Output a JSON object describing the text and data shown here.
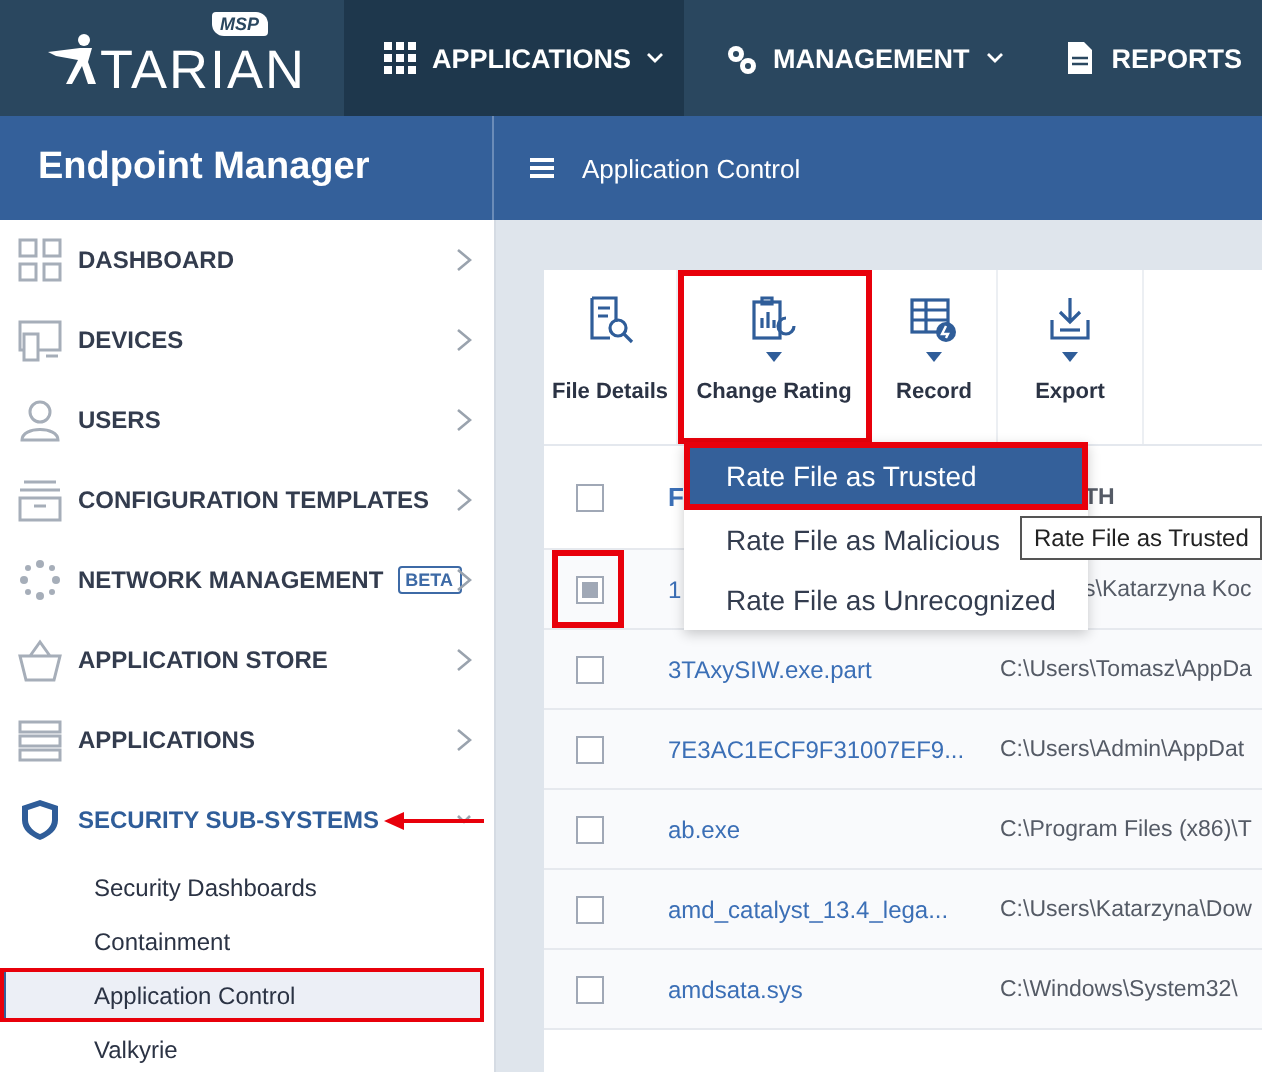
{
  "app_header": {
    "logo": {
      "text": "TARIAN",
      "badge": "MSP"
    },
    "nav": [
      {
        "label": "APPLICATIONS",
        "selected": true,
        "dropdown": true
      },
      {
        "label": "MANAGEMENT",
        "selected": false,
        "dropdown": true
      },
      {
        "label": "REPORTS",
        "selected": false,
        "dropdown": false
      }
    ]
  },
  "sidebar": {
    "title": "Endpoint Manager",
    "items": [
      {
        "label": "DASHBOARD",
        "expanded": false,
        "arrow": false
      },
      {
        "label": "DEVICES",
        "expanded": false,
        "arrow": false
      },
      {
        "label": "USERS",
        "expanded": false,
        "arrow": false
      },
      {
        "label": "CONFIGURATION TEMPLATES",
        "expanded": false,
        "arrow": false
      },
      {
        "label": "NETWORK MANAGEMENT",
        "badge": "BETA",
        "expanded": false,
        "arrow": false
      },
      {
        "label": "APPLICATION STORE",
        "expanded": false,
        "arrow": false
      },
      {
        "label": "APPLICATIONS",
        "expanded": false,
        "arrow": false
      },
      {
        "label": "SECURITY SUB-SYSTEMS",
        "expanded": true,
        "arrow": true,
        "children": [
          {
            "label": "Security Dashboards",
            "selected": false,
            "highlighted": false
          },
          {
            "label": "Containment",
            "selected": false,
            "highlighted": false
          },
          {
            "label": "Application Control",
            "selected": true,
            "highlighted": true
          },
          {
            "label": "Valkyrie",
            "selected": false,
            "highlighted": false
          }
        ]
      }
    ]
  },
  "page_title": "Application Control",
  "toolbar": [
    {
      "label": "File Details",
      "dropdown": false,
      "highlighted": false
    },
    {
      "label": "Change Rating",
      "dropdown": true,
      "highlighted": true
    },
    {
      "label": "Record",
      "dropdown": true,
      "highlighted": false
    },
    {
      "label": "Export",
      "dropdown": true,
      "highlighted": false
    }
  ],
  "dropdown_menu": [
    {
      "label": "Rate File as Trusted",
      "selected": true,
      "highlighted": true
    },
    {
      "label": "Rate File as Malicious",
      "selected": false,
      "highlighted": false
    },
    {
      "label": "Rate File as Unrecognized",
      "selected": false,
      "highlighted": false
    }
  ],
  "tooltip": "Rate File as Trusted",
  "table": {
    "columns": [
      "F",
      "TH"
    ],
    "header_checked": false,
    "rows": [
      {
        "checked": true,
        "highlighted": true,
        "name": "1",
        "path": "s\\Katarzyna Koc"
      },
      {
        "checked": false,
        "highlighted": false,
        "name": "3TAxySIW.exe.part",
        "path": "C:\\Users\\Tomasz\\AppDa"
      },
      {
        "checked": false,
        "highlighted": false,
        "name": "7E3AC1ECF9F31007EF9...",
        "path": "C:\\Users\\Admin\\AppDat"
      },
      {
        "checked": false,
        "highlighted": false,
        "name": "ab.exe",
        "path": "C:\\Program Files (x86)\\T"
      },
      {
        "checked": false,
        "highlighted": false,
        "name": "amd_catalyst_13.4_lega...",
        "path": "C:\\Users\\Katarzyna\\Dow"
      },
      {
        "checked": false,
        "highlighted": false,
        "name": "amdsata.sys",
        "path": "C:\\Windows\\System32\\"
      }
    ]
  }
}
